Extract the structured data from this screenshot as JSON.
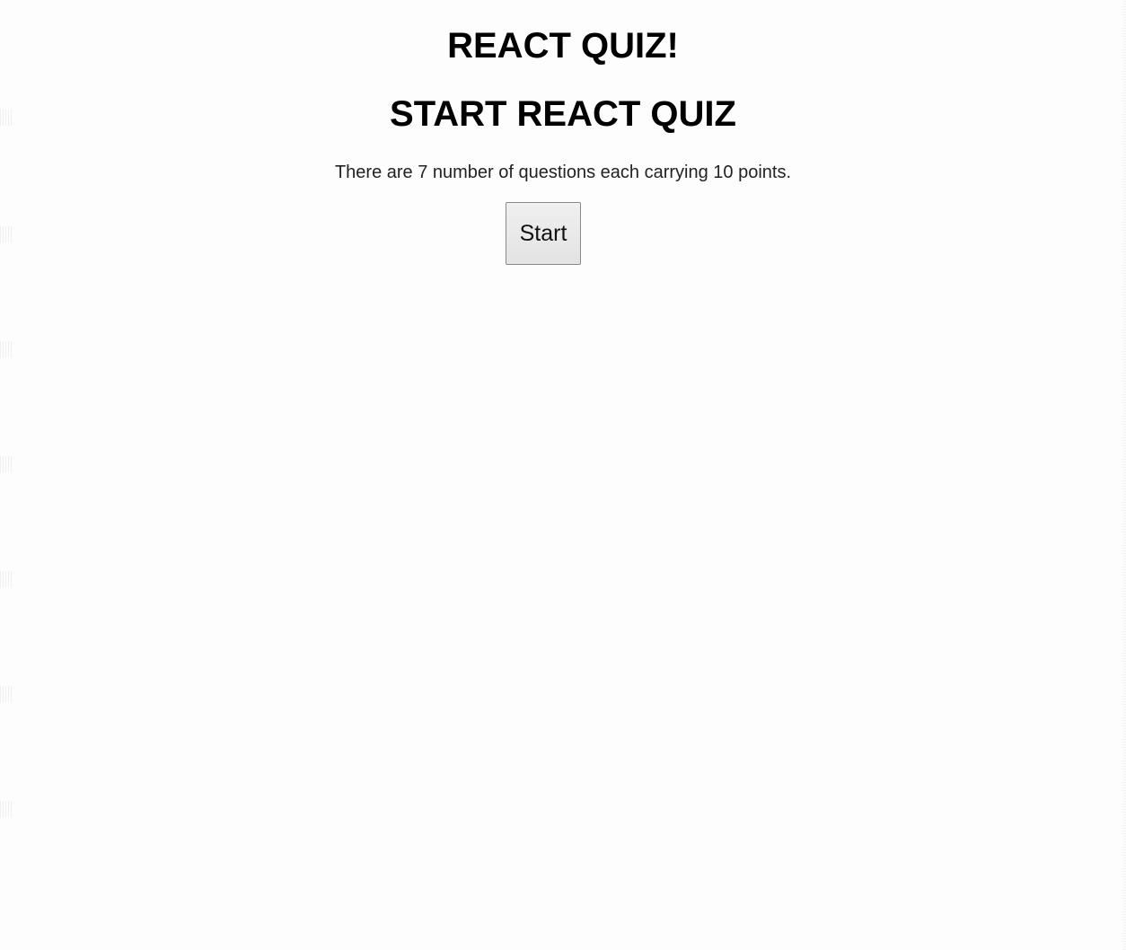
{
  "app": {
    "title": "REACT QUIZ!"
  },
  "quiz": {
    "heading": "START REACT QUIZ",
    "info": "There are 7 number of questions each carrying 10 points.",
    "start_label": "Start"
  }
}
